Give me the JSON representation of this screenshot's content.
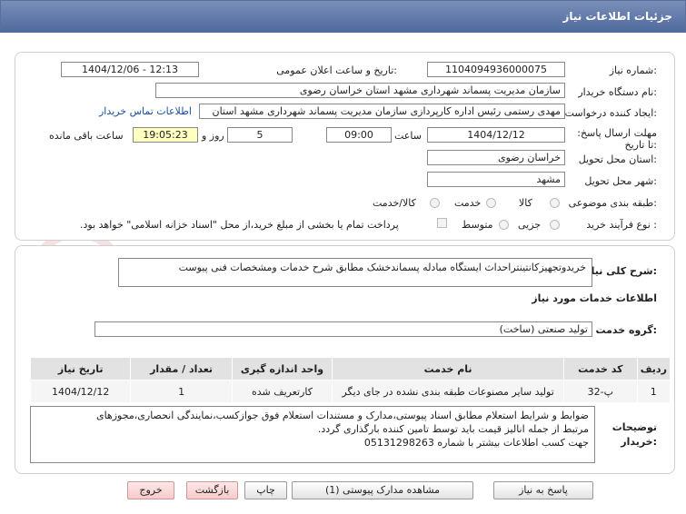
{
  "header": {
    "title": "جزئیات اطلاعات نیاز"
  },
  "labels": {
    "need_number": "شماره نیاز:",
    "announce_datetime": "تاریخ و ساعت اعلان عمومی:",
    "buyer_org": "نام دستگاه خریدار:",
    "request_creator": "ایجاد کننده درخواست:",
    "reply_deadline": "مهلت ارسال پاسخ: تا تاریخ:",
    "time_word": "ساعت",
    "days_word": "روز و",
    "remaining_word": "ساعت باقی مانده",
    "delivery_province": "استان محل تحویل:",
    "delivery_city": "شهر محل تحویل:",
    "subject_category": "طبقه بندی موضوعی:",
    "purchase_type": "نوع فرآیند خرید :",
    "general_desc": "شرح کلی نیاز:",
    "services_info": "اطلاعات خدمات مورد نیاز",
    "service_group": "گروه خدمت:",
    "buyer_notes": "توضیحات خریدار:"
  },
  "fields": {
    "need_number": "1104094936000075",
    "announce_datetime": "1404/12/06 - 12:13",
    "buyer_org": "سازمان مدیریت پسماند شهرداری مشهد استان خراسان رضوی",
    "request_creator": "مهدی رستمی رئیس اداره کارپردازی سازمان مدیریت پسماند شهرداری مشهد استان",
    "contact_link": "اطلاعات تماس خریدار",
    "reply_date": "1404/12/12",
    "reply_time": "09:00",
    "days_remaining": "5",
    "time_remaining": "19:05:23",
    "delivery_province": "خراسان رضوی",
    "delivery_city": "مشهد",
    "general_desc": "خریدوتجهیزکانتینتراحداث ایستگاه مبادله پسماندخشک مطابق شرح خدمات ومشخصات فنی پیوست",
    "service_group": "تولید صنعتی (ساخت)"
  },
  "subject_options": [
    "کالا",
    "خدمت",
    "کالا/خدمت"
  ],
  "purchase_options": [
    "جزیی",
    "متوسط"
  ],
  "payment_note": "پرداخت تمام یا بخشی از مبلغ خرید،از محل \"اسناد خزانه اسلامی\" خواهد بود.",
  "table": {
    "headers": [
      "ردیف",
      "کد خدمت",
      "نام خدمت",
      "واحد اندازه گیری",
      "تعداد / مقدار",
      "تاریخ نیاز"
    ],
    "rows": [
      [
        "1",
        "پ-32",
        "تولید سایر مصنوعات طبقه بندی نشده در جای دیگر",
        "کارتعریف شده",
        "1",
        "1404/12/12"
      ]
    ]
  },
  "buyer_notes": {
    "line1": "ضوابط و شرایط استعلام مطابق اسناد پیوستی،مدارک و مستندات استعلام فوق جوازکسب،نمایندگی انحصاری،مجوزهای",
    "line2": "مرتبط از جمله انالیز قیمت باید توسط تامین کننده بارگذاری گردد.",
    "line3": "جهت کسب اطلاعات بیشتر با شماره 05131298263"
  },
  "buttons": {
    "reply": "پاسخ به نیاز",
    "view_docs": "مشاهده مدارک پیوستی (1)",
    "print": "چاپ",
    "back": "بازگشت",
    "exit": "خروج"
  },
  "watermark_text": "AriaTender.net",
  "colors": {
    "header_bg": "#5f77a8",
    "link": "#1a4fa0",
    "highlight": "#ffffc0"
  }
}
